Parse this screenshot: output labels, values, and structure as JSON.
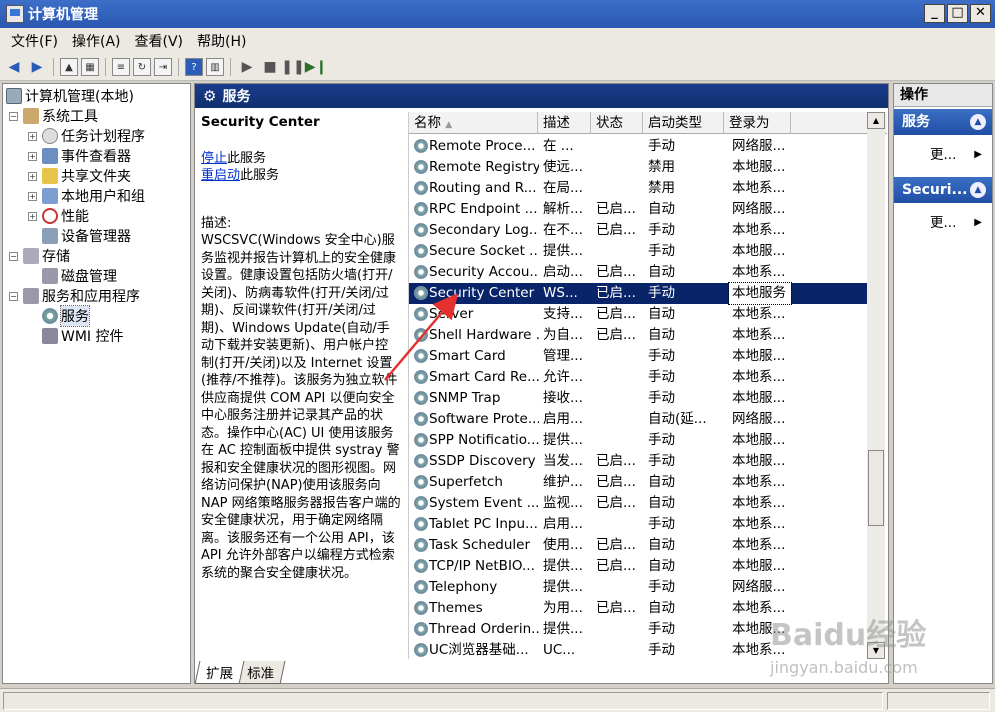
{
  "window": {
    "title": "计算机管理"
  },
  "menu": [
    "文件(F)",
    "操作(A)",
    "查看(V)",
    "帮助(H)"
  ],
  "tree": {
    "root": "计算机管理(本地)",
    "system_tools": "系统工具",
    "task_scheduler": "任务计划程序",
    "event_viewer": "事件查看器",
    "shared_folders": "共享文件夹",
    "local_users": "本地用户和组",
    "performance": "性能",
    "device_manager": "设备管理器",
    "storage": "存储",
    "disk_management": "磁盘管理",
    "services_apps": "服务和应用程序",
    "services": "服务",
    "wmi": "WMI 控件"
  },
  "panel": {
    "header": "服务",
    "service_title": "Security Center",
    "stop_link": "停止",
    "stop_suffix": "此服务",
    "restart_link": "重启动",
    "restart_suffix": "此服务",
    "description": "描述:\nWSCSVC(Windows 安全中心)服务监视并报告计算机上的安全健康设置。健康设置包括防火墙(打开/关闭)、防病毒软件(打开/关闭/过期)、反间谍软件(打开/关闭/过期)、Windows Update(自动/手动下载并安装更新)、用户帐户控制(打开/关闭)以及 Internet 设置(推荐/不推荐)。该服务为独立软件供应商提供 COM API 以便向安全中心服务注册并记录其产品的状态。操作中心(AC) UI 使用该服务在 AC 控制面板中提供 systray 警报和安全健康状况的图形视图。网络访问保护(NAP)使用该服务向 NAP 网络策略服务器报告客户端的安全健康状况，用于确定网络隔离。该服务还有一个公用 API，该 API 允许外部客户以编程方式检索系统的聚合安全健康状况。"
  },
  "columns": [
    "名称",
    "描述",
    "状态",
    "启动类型",
    "登录为"
  ],
  "services": [
    {
      "name": "Remote Proce...",
      "desc": "在 ...",
      "status": "",
      "startup": "手动",
      "logon": "网络服..."
    },
    {
      "name": "Remote Registry",
      "desc": "使远...",
      "status": "",
      "startup": "禁用",
      "logon": "本地服..."
    },
    {
      "name": "Routing and R...",
      "desc": "在局...",
      "status": "",
      "startup": "禁用",
      "logon": "本地系..."
    },
    {
      "name": "RPC Endpoint ...",
      "desc": "解析...",
      "status": "已启...",
      "startup": "自动",
      "logon": "网络服..."
    },
    {
      "name": "Secondary Log...",
      "desc": "在不...",
      "status": "已启...",
      "startup": "手动",
      "logon": "本地系..."
    },
    {
      "name": "Secure Socket ...",
      "desc": "提供...",
      "status": "",
      "startup": "手动",
      "logon": "本地服..."
    },
    {
      "name": "Security Accou...",
      "desc": "启动...",
      "status": "已启...",
      "startup": "自动",
      "logon": "本地系..."
    },
    {
      "name": "Security Center",
      "desc": "WS...",
      "status": "已启...",
      "startup": "手动",
      "logon": "本地服务",
      "selected": true
    },
    {
      "name": "Server",
      "desc": "支持...",
      "status": "已启...",
      "startup": "自动",
      "logon": "本地系..."
    },
    {
      "name": "Shell Hardware ...",
      "desc": "为自...",
      "status": "已启...",
      "startup": "自动",
      "logon": "本地系..."
    },
    {
      "name": "Smart Card",
      "desc": "管理...",
      "status": "",
      "startup": "手动",
      "logon": "本地服..."
    },
    {
      "name": "Smart Card Re...",
      "desc": "允许...",
      "status": "",
      "startup": "手动",
      "logon": "本地系..."
    },
    {
      "name": "SNMP Trap",
      "desc": "接收...",
      "status": "",
      "startup": "手动",
      "logon": "本地服..."
    },
    {
      "name": "Software Prote...",
      "desc": "启用...",
      "status": "",
      "startup": "自动(延...",
      "logon": "网络服..."
    },
    {
      "name": "SPP Notificatio...",
      "desc": "提供...",
      "status": "",
      "startup": "手动",
      "logon": "本地服..."
    },
    {
      "name": "SSDP Discovery",
      "desc": "当发...",
      "status": "已启...",
      "startup": "手动",
      "logon": "本地服..."
    },
    {
      "name": "Superfetch",
      "desc": "维护...",
      "status": "已启...",
      "startup": "自动",
      "logon": "本地系..."
    },
    {
      "name": "System Event ...",
      "desc": "监视...",
      "status": "已启...",
      "startup": "自动",
      "logon": "本地系..."
    },
    {
      "name": "Tablet PC Inpu...",
      "desc": "启用...",
      "status": "",
      "startup": "手动",
      "logon": "本地系..."
    },
    {
      "name": "Task Scheduler",
      "desc": "使用...",
      "status": "已启...",
      "startup": "自动",
      "logon": "本地系..."
    },
    {
      "name": "TCP/IP NetBIO...",
      "desc": "提供...",
      "status": "已启...",
      "startup": "自动",
      "logon": "本地服..."
    },
    {
      "name": "Telephony",
      "desc": "提供...",
      "status": "",
      "startup": "手动",
      "logon": "网络服..."
    },
    {
      "name": "Themes",
      "desc": "为用...",
      "status": "已启...",
      "startup": "自动",
      "logon": "本地系..."
    },
    {
      "name": "Thread Orderin...",
      "desc": "提供...",
      "status": "",
      "startup": "手动",
      "logon": "本地服..."
    },
    {
      "name": "UC浏览器基础...",
      "desc": "UC...",
      "status": "",
      "startup": "手动",
      "logon": "本地系..."
    }
  ],
  "tabs": [
    "扩展",
    "标准"
  ],
  "actions": {
    "title": "操作",
    "section1": "服务",
    "more1": "更...",
    "section2": "Securi...",
    "more2": "更..."
  },
  "watermark": {
    "main": "Baidu经验",
    "sub": "jingyan.baidu.com"
  }
}
